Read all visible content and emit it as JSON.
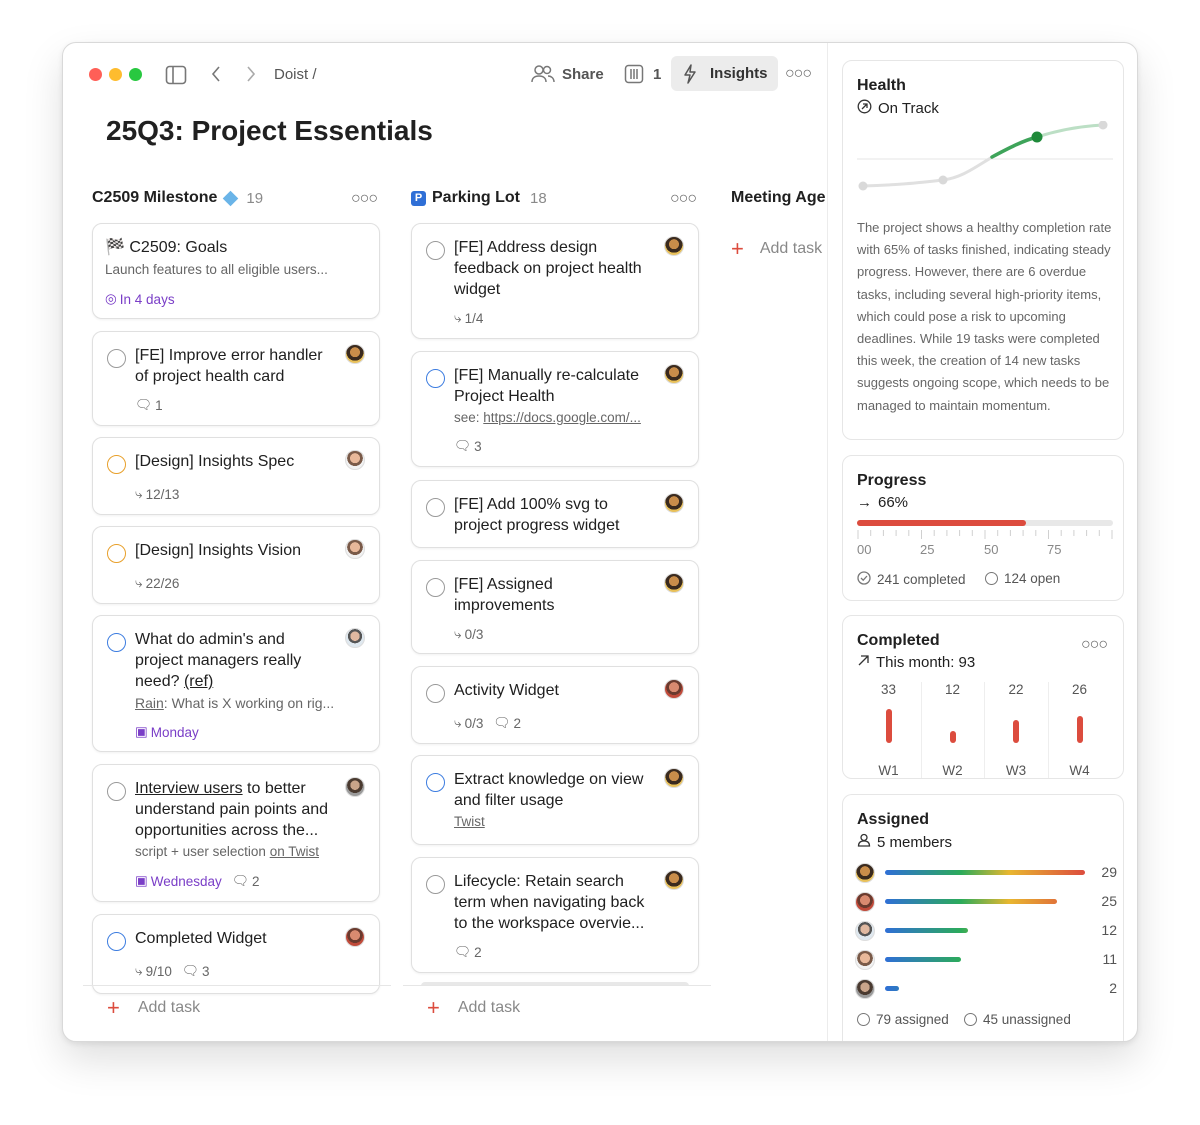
{
  "toolbar": {
    "breadcrumb": "Doist /",
    "share_label": "Share",
    "view_count": "1",
    "insights_label": "Insights"
  },
  "page_title": "25Q3: Project Essentials",
  "columns": [
    {
      "name": "C2509 Milestone",
      "count": "19"
    },
    {
      "name": "Parking Lot",
      "count": "18"
    },
    {
      "name": "Meeting Age"
    }
  ],
  "add_task_label": "Add task",
  "milestone_cards": [
    {
      "title": "🏁 C2509: Goals",
      "subtitle": "Launch features to all eligible users...",
      "due": "In 4 days"
    },
    {
      "title": "[FE] Improve error handler of project health card",
      "comments": "1"
    },
    {
      "title": "[Design] Insights Spec",
      "subtasks": "12/13"
    },
    {
      "title": "[Design] Insights Vision",
      "subtasks": "22/26"
    },
    {
      "title": "What do admin's and project managers really need?",
      "title_ref": "(ref)",
      "sub_link": "Rain",
      "sub_rest": ": What is X working on rig...",
      "due": "Monday"
    },
    {
      "title_link": "Interview users",
      "title_rest": " to better understand pain points and opportunities across the...",
      "sub_text": "script + user selection ",
      "sub_link": "on Twist",
      "due": "Wednesday",
      "comments": "2"
    },
    {
      "title": "Completed Widget",
      "subtasks": "9/10",
      "comments": "3"
    }
  ],
  "parking_cards": [
    {
      "title": "[FE] Address design feedback on project health widget",
      "subtasks": "1/4"
    },
    {
      "title": "[FE] Manually re-calculate Project Health",
      "sub_text": "see: ",
      "sub_link": "https://docs.google.com/...",
      "comments": "3"
    },
    {
      "title": "[FE] Add 100% svg to project progress widget"
    },
    {
      "title": "[FE] Assigned improvements",
      "subtasks": "0/3"
    },
    {
      "title": "Activity Widget",
      "subtasks": "0/3",
      "comments": "2"
    },
    {
      "title": "Extract knowledge on view and filter usage",
      "sub_link": "Twist"
    },
    {
      "title": "Lifecycle: Retain search term when navigating back to the workspace overvie...",
      "comments": "2"
    }
  ],
  "health": {
    "title": "Health",
    "status": "On Track",
    "summary": "The project shows a healthy completion rate with 65% of tasks finished, indicating steady progress. However, there are 6 overdue tasks, including several high-priority items, which could pose a risk to upcoming deadlines. While 19 tasks were completed this week, the creation of 14 new tasks suggests ongoing scope, which needs to be managed to maintain momentum."
  },
  "progress": {
    "title": "Progress",
    "value_label": "66%",
    "value": 66,
    "ticks": [
      "00",
      "25",
      "50",
      "75"
    ],
    "completed_label": "241 completed",
    "open_label": "124 open"
  },
  "completed": {
    "title": "Completed",
    "month_label": "This month: 93",
    "weeks": [
      {
        "week": "W1",
        "count": 33
      },
      {
        "week": "W2",
        "count": 12
      },
      {
        "week": "W3",
        "count": 22
      },
      {
        "week": "W4",
        "count": 26
      }
    ]
  },
  "assigned": {
    "title": "Assigned",
    "members_label": "5 members",
    "members": [
      {
        "count": 29
      },
      {
        "count": 25
      },
      {
        "count": 12
      },
      {
        "count": 11
      },
      {
        "count": 2
      }
    ],
    "assigned_label": "79 assigned",
    "unassigned_label": "45 unassigned"
  },
  "colors": {
    "accent": "#dc4c3e",
    "purple": "#7a3ec7",
    "health_green": "#1f8a3a"
  }
}
